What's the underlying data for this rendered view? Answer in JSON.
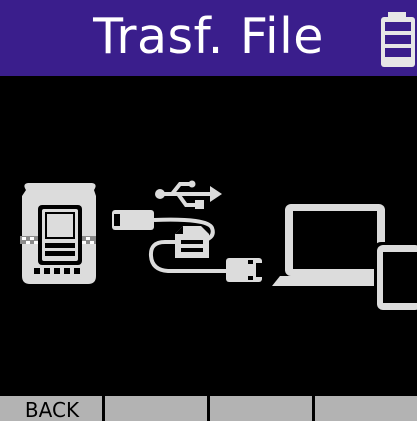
{
  "screen": {
    "title": "Trasf. File",
    "battery_icon": "battery-icon",
    "illustration_icons": [
      "recorder-device-icon",
      "usb-symbol-icon",
      "usb-cable-icon",
      "file-icon",
      "laptop-icon",
      "tablet-icon"
    ]
  },
  "softkeys": [
    {
      "label": "BACK"
    },
    {
      "label": ""
    },
    {
      "label": ""
    },
    {
      "label": ""
    }
  ],
  "colors": {
    "title_bar": "#3a1e8c",
    "background": "#000000",
    "illustration": "#dcdcdc",
    "softkey": "#b3b3b3"
  }
}
